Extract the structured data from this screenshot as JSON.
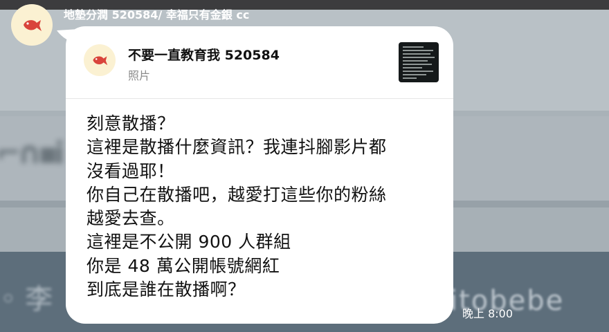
{
  "sender": {
    "name": "地墊分潤 520584/ 幸福只有金銀 cc",
    "avatar_icon": "red-fish-icon"
  },
  "reply_preview": {
    "name": "不要一直教育我 520584",
    "type": "照片",
    "avatar_icon": "red-fish-icon",
    "thumbnail_icon": "dark-document-photo-thumbnail"
  },
  "message": {
    "lines": [
      "刻意散播？",
      "這裡是散播什麼資訊？我連抖腳影片都",
      "沒看過耶！",
      "你自己在散播吧，越愛打這些你的粉絲",
      "越愛去查。",
      "這裡是不公開 900 人群組",
      "你是 48 萬公開帳號網紅",
      "到底是誰在散播啊？"
    ]
  },
  "timestamp": "晚上 8:00",
  "colors": {
    "bubble": "#ffffff",
    "avatar_bg": "#fbf1d2",
    "fish": "#d9443b",
    "background": "#6c7c88"
  }
}
